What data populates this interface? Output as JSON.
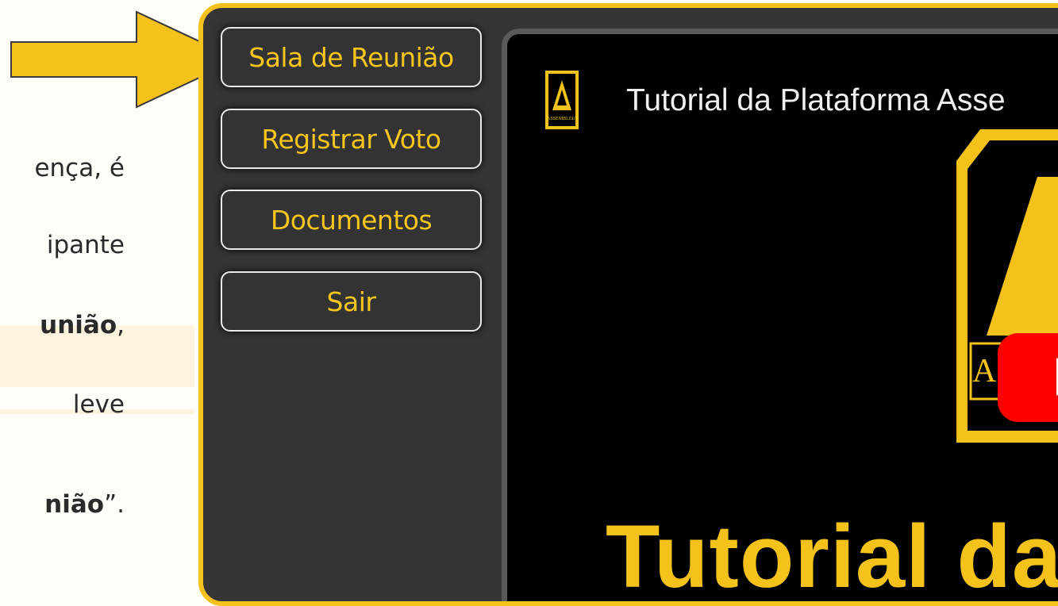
{
  "left_text": {
    "line1": "ença, é",
    "line2": "ipante",
    "line3_bold": "união",
    "line3_tail": ",",
    "line4": "leve",
    "line5_bold": "nião",
    "line5_tail": "”."
  },
  "nav": {
    "meeting_room": "Sala de Reunião",
    "register_vote": "Registrar Voto",
    "documents": "Documentos",
    "exit": "Sair"
  },
  "video": {
    "title": "Tutorial da Plataforma Asse",
    "caption": "Tutorial da",
    "logo_text": "ASSEM",
    "channel_logo_text": "ASSEMBLEIA"
  },
  "colors": {
    "accent_yellow": "#f4c21b",
    "panel_dark": "#353535",
    "youtube_red": "#ff0000"
  },
  "icons": {
    "arrow": "arrow-right-icon",
    "play": "youtube-play-icon"
  }
}
